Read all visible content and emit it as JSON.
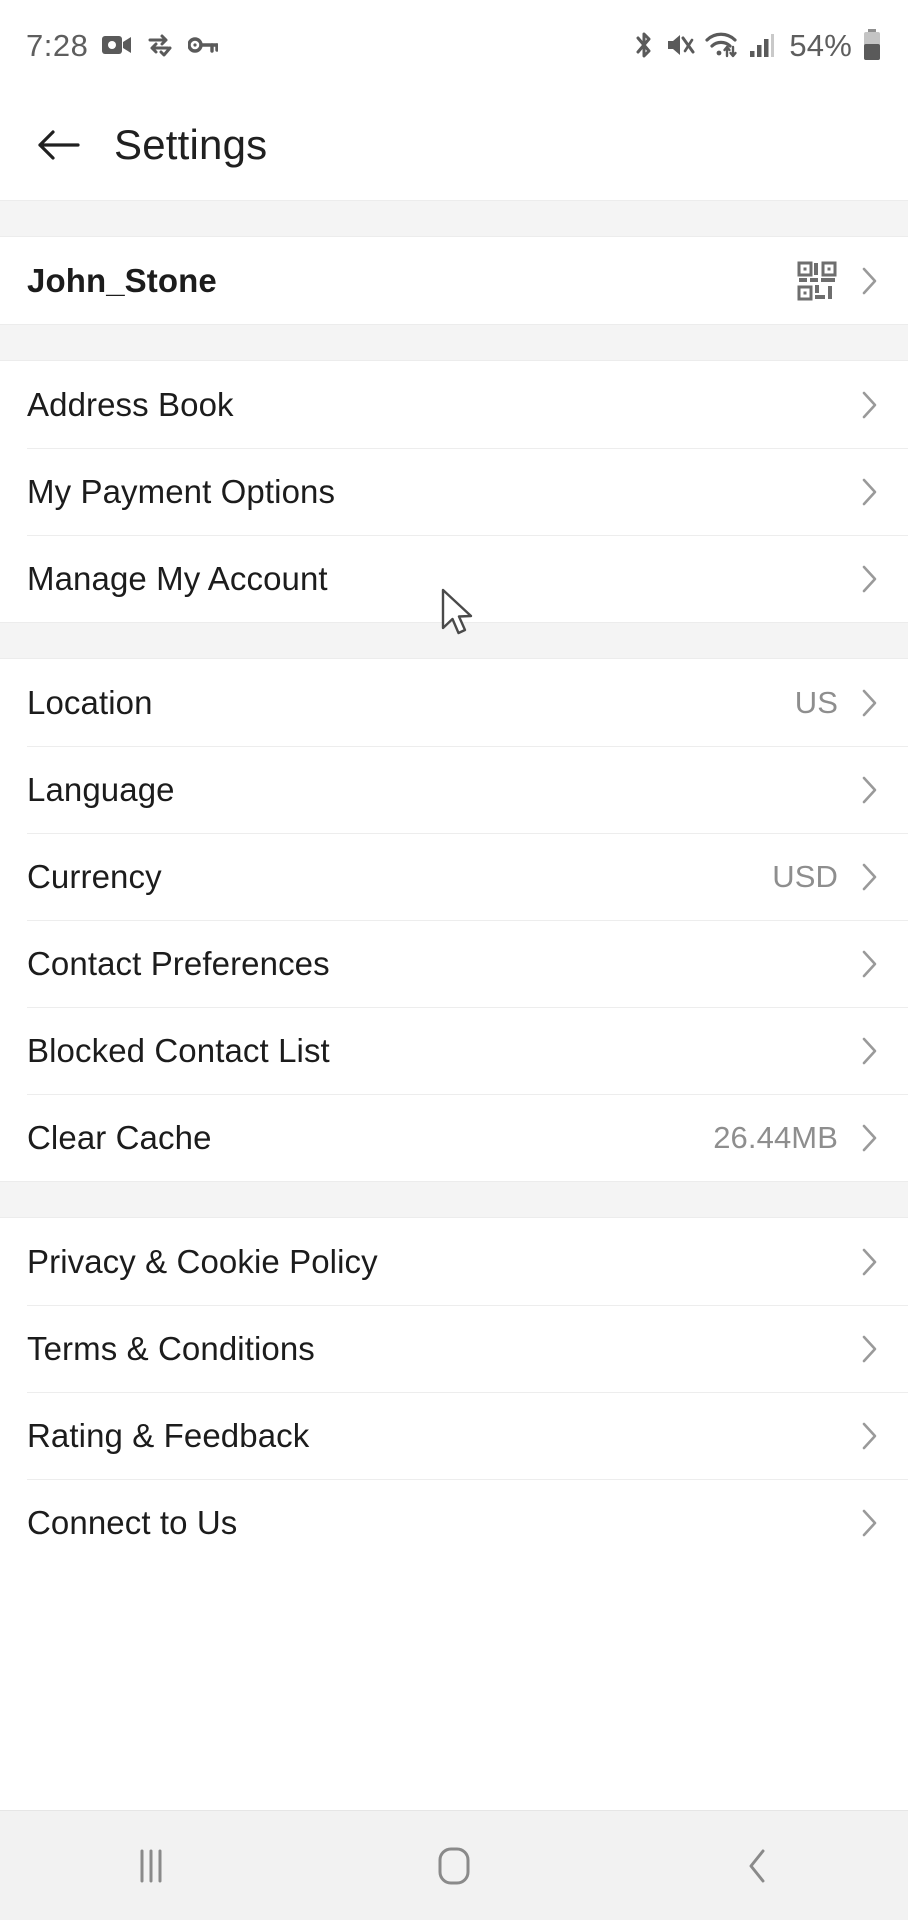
{
  "status_bar": {
    "time": "7:28",
    "battery_percent": "54%",
    "left_icons": [
      "video-camera-icon",
      "data-sync-check-icon",
      "vpn-key-icon"
    ],
    "right_icons": [
      "bluetooth-icon",
      "volume-mute-icon",
      "wifi-icon",
      "cellular-signal-icon",
      "battery-icon"
    ]
  },
  "header": {
    "back_label": "back-arrow",
    "title": "Settings"
  },
  "account": {
    "username": "John_Stone",
    "qr_icon": "qr-code-icon"
  },
  "groups": [
    {
      "id": "account-group",
      "items": [
        {
          "label": "Address Book",
          "value": ""
        },
        {
          "label": "My Payment Options",
          "value": ""
        },
        {
          "label": "Manage My Account",
          "value": ""
        }
      ]
    },
    {
      "id": "preferences-group",
      "items": [
        {
          "label": "Location",
          "value": "US"
        },
        {
          "label": "Language",
          "value": ""
        },
        {
          "label": "Currency",
          "value": "USD"
        },
        {
          "label": "Contact Preferences",
          "value": ""
        },
        {
          "label": "Blocked Contact List",
          "value": ""
        },
        {
          "label": "Clear Cache",
          "value": "26.44MB"
        }
      ]
    },
    {
      "id": "legal-group",
      "items": [
        {
          "label": "Privacy & Cookie Policy",
          "value": ""
        },
        {
          "label": "Terms & Conditions",
          "value": ""
        },
        {
          "label": "Rating & Feedback",
          "value": ""
        },
        {
          "label": "Connect to Us",
          "value": ""
        }
      ]
    }
  ],
  "nav_bar": {
    "recents_label": "recents-icon",
    "home_label": "home-icon",
    "back_label": "back-icon"
  },
  "colors": {
    "background": "#ffffff",
    "group_separator": "#f4f4f4",
    "divider": "#ededed",
    "primary_text": "#1c1c1c",
    "secondary_text": "#8e8e8e",
    "chevron": "#9a9a9a",
    "nav_bar_bg": "#f2f2f2"
  }
}
